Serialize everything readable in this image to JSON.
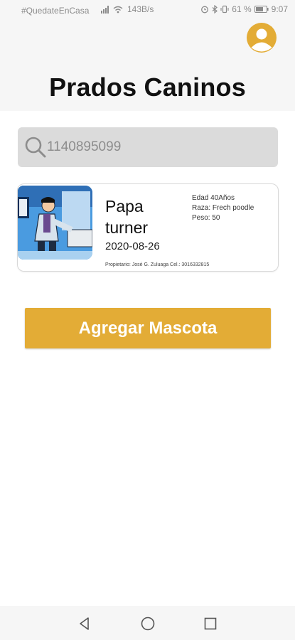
{
  "status_bar": {
    "carrier": "#QuedateEnCasa",
    "speed": "143B/s",
    "battery": "61 %",
    "time": "9:07"
  },
  "header": {
    "title": "Prados Caninos",
    "profile_icon": "user-profile-icon"
  },
  "search": {
    "value": "1140895099",
    "icon": "search-icon"
  },
  "pets": [
    {
      "name": "Papa turner",
      "date": "2020-08-26",
      "age": "Edad 40Años",
      "breed": "Raza: Frech poodle",
      "weight": "Peso: 50",
      "owner": "Propietario: José G. Zuluaga Cel.: 3016332815"
    }
  ],
  "actions": {
    "add_pet": "Agregar Mascota"
  },
  "navigation": {
    "back_icon": "back-triangle-icon",
    "home_icon": "home-circle-icon",
    "recents_icon": "recents-square-icon"
  },
  "colors": {
    "accent": "#e3ac36",
    "search_bg": "#dbdbdb",
    "header_bg": "#f6f6f6"
  }
}
